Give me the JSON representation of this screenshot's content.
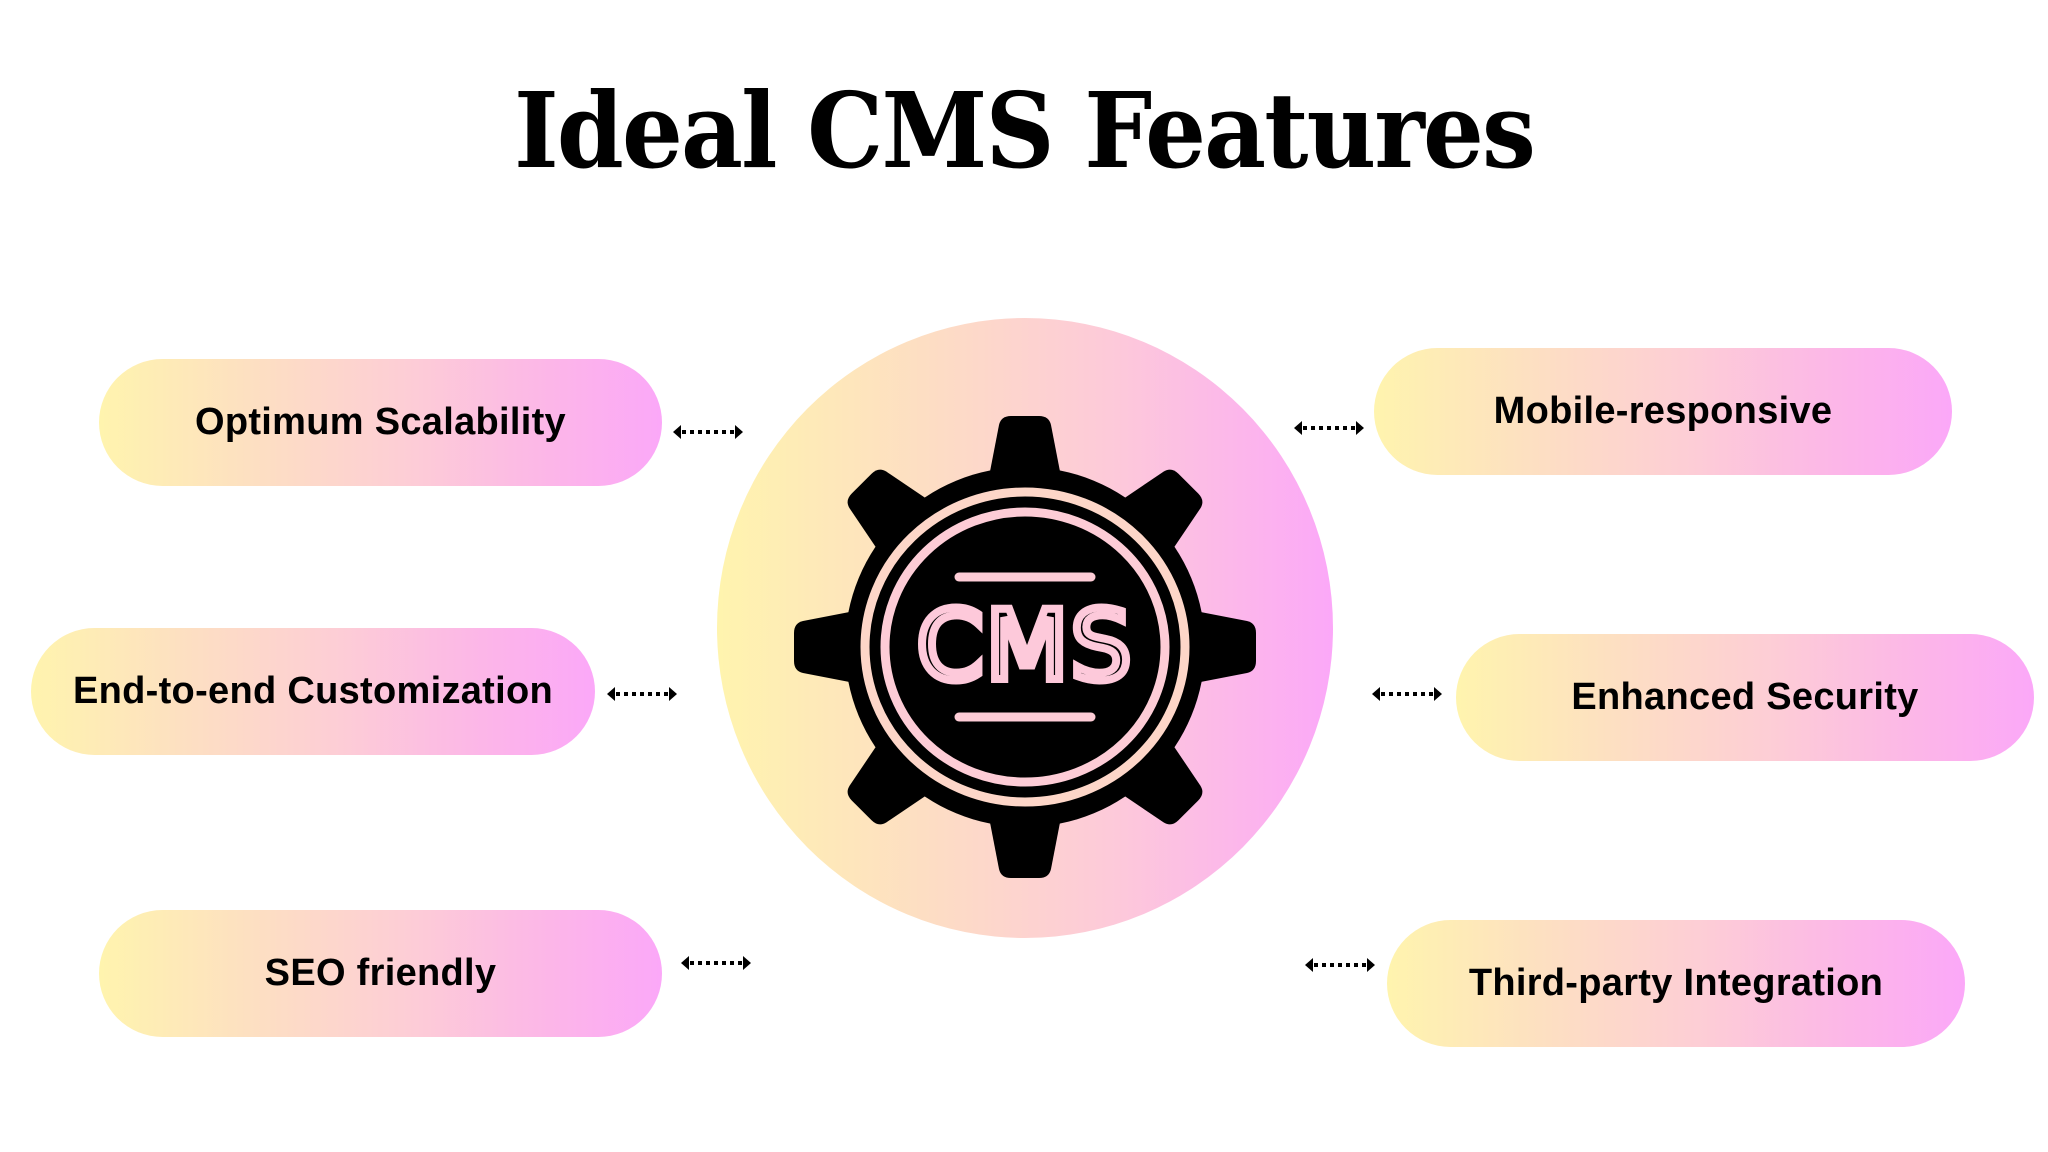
{
  "title": "Ideal CMS Features",
  "center": {
    "icon": "gear-icon",
    "label": "CMS"
  },
  "colors": {
    "gradient_start": "#fff4ae",
    "gradient_end": "#fba8f8",
    "text": "#000000",
    "gear": "#000000",
    "gear_inner_line": "#fdccd6"
  },
  "features_left": [
    {
      "label": "Optimum Scalability",
      "connector": "double-arrow-icon"
    },
    {
      "label": "End-to-end Customization",
      "connector": "double-arrow-icon"
    },
    {
      "label": "SEO friendly",
      "connector": "double-arrow-icon"
    }
  ],
  "features_right": [
    {
      "label": "Mobile-responsive",
      "connector": "double-arrow-icon"
    },
    {
      "label": "Enhanced Security",
      "connector": "double-arrow-icon"
    },
    {
      "label": "Third-party Integration",
      "connector": "double-arrow-icon"
    }
  ]
}
